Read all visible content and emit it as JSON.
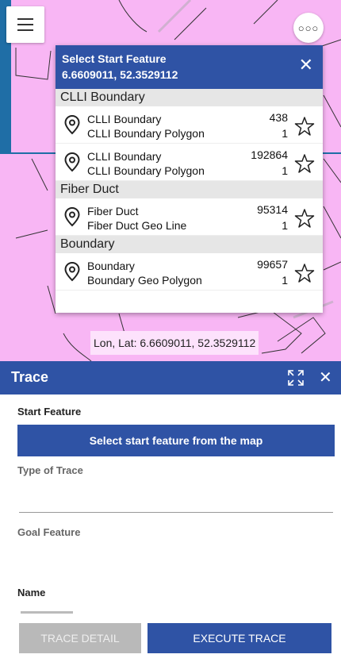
{
  "colors": {
    "map_bg": "#f8b6f4",
    "primary": "#2f53a5",
    "disabled": "#b9b9b9"
  },
  "icons": {
    "menu": "hamburger-icon",
    "more": "more-icon",
    "close": "close-icon",
    "pin": "location-pin-icon",
    "star": "star-icon",
    "expand": "expand-icon"
  },
  "popup": {
    "title": "Select Start Feature",
    "coords": "6.6609011, 52.3529112",
    "close": "✕",
    "groups": [
      {
        "label": "CLLI Boundary",
        "items": [
          {
            "line1": "CLLI Boundary",
            "line2": "CLLI Boundary Polygon",
            "id": "438",
            "count": "1"
          },
          {
            "line1": "CLLI Boundary",
            "line2": "CLLI Boundary Polygon",
            "id": "192864",
            "count": "1"
          }
        ]
      },
      {
        "label": "Fiber Duct",
        "items": [
          {
            "line1": "Fiber Duct",
            "line2": "Fiber Duct Geo Line",
            "id": "95314",
            "count": "1"
          }
        ]
      },
      {
        "label": "Boundary",
        "items": [
          {
            "line1": "Boundary",
            "line2": "Boundary Geo Polygon",
            "id": "99657",
            "count": "1"
          }
        ]
      }
    ]
  },
  "map": {
    "lonlat": "Lon, Lat:  6.6609011, 52.3529112"
  },
  "trace": {
    "title": "Trace",
    "close": "✕",
    "start_label": "Start Feature",
    "select_button": "Select start feature from the map",
    "type_label": "Type of Trace",
    "goal_label": "Goal Feature",
    "name_label": "Name",
    "detail_button": "TRACE DETAIL",
    "execute_button": "EXECUTE TRACE"
  }
}
